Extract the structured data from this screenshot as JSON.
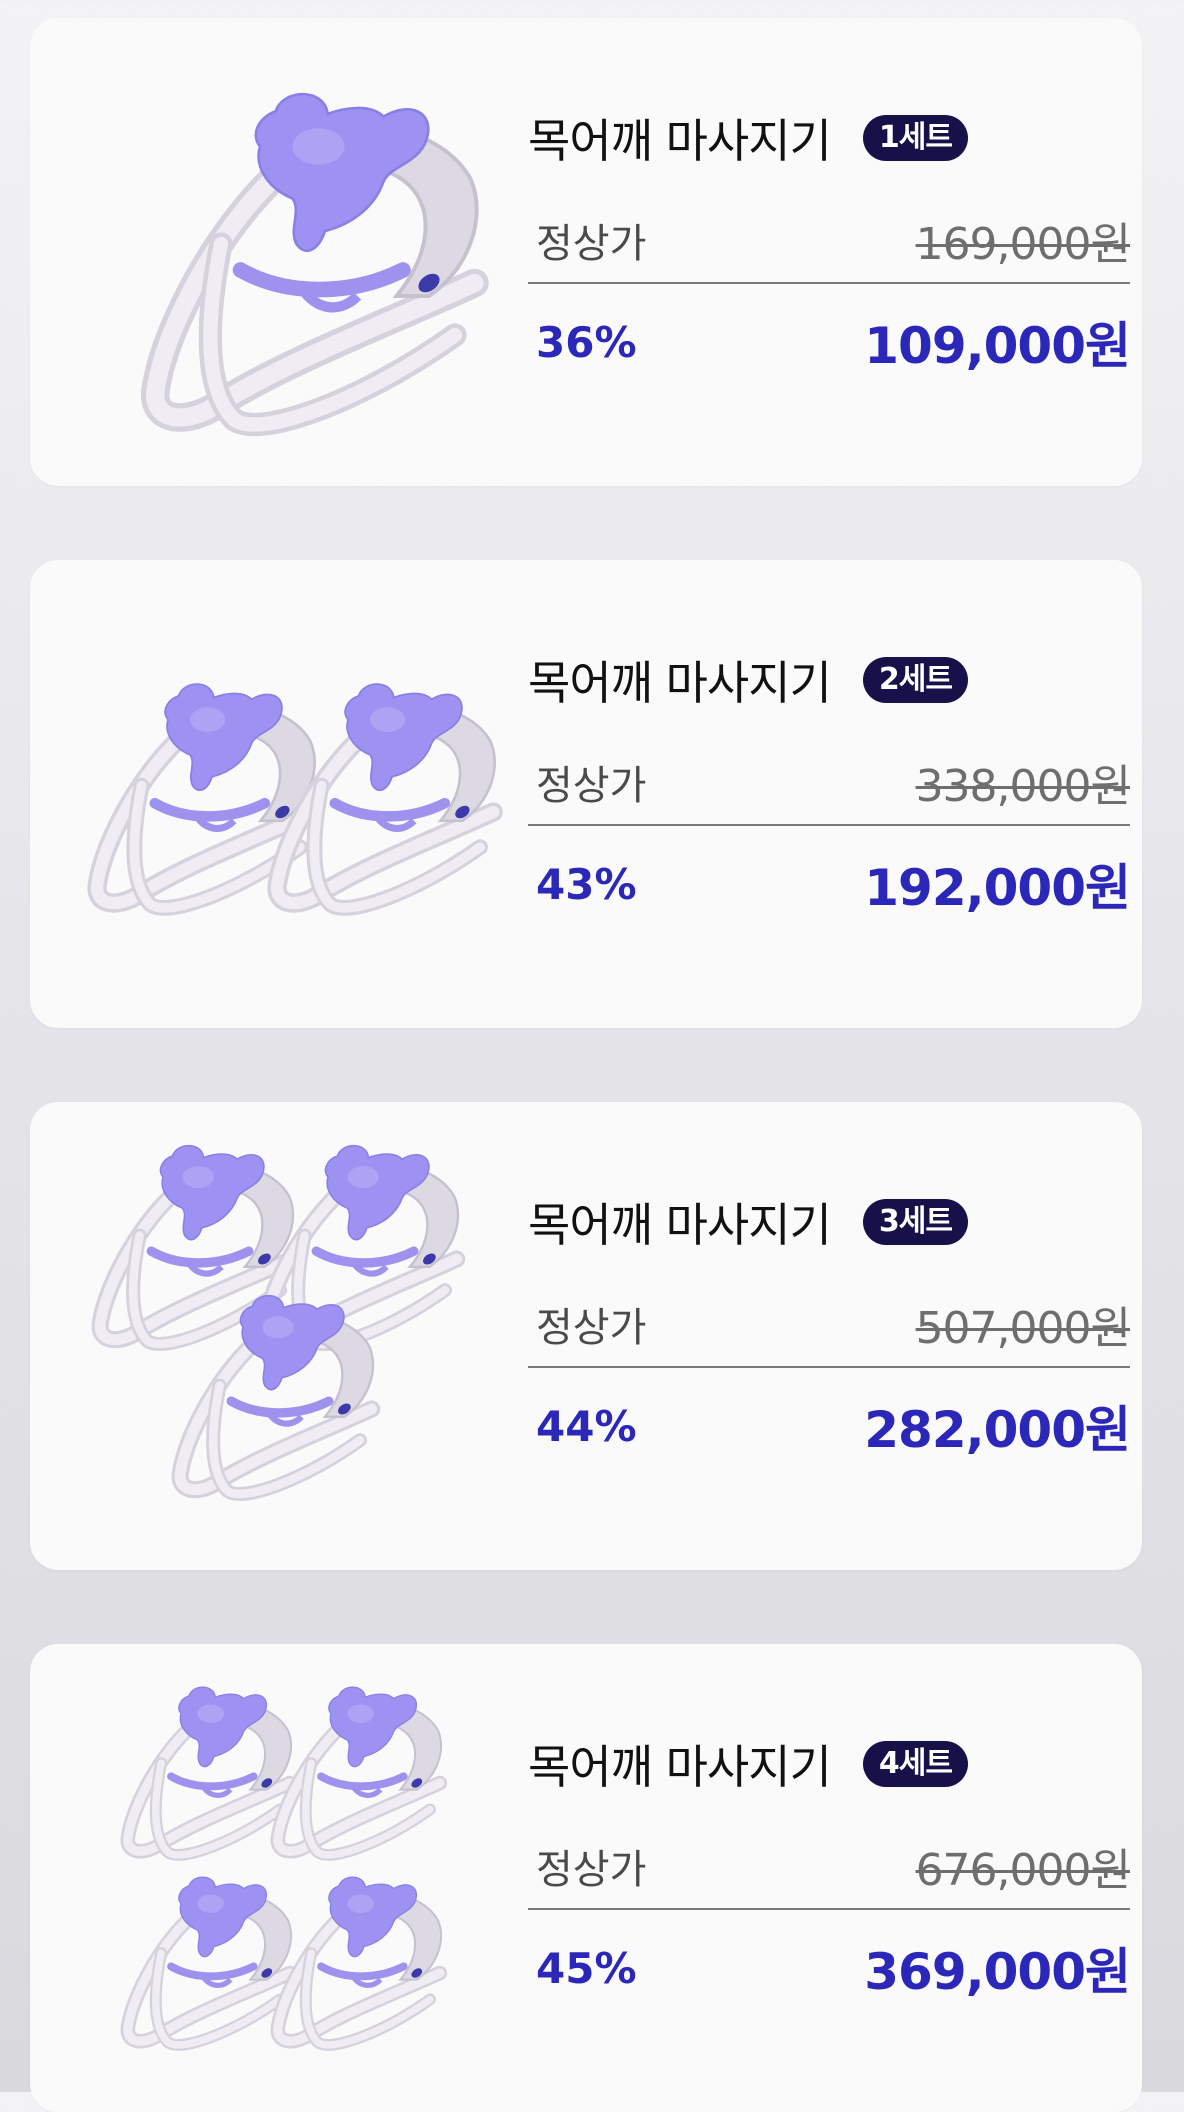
{
  "colors": {
    "accent": "#2b27b8",
    "badge_bg": "#17114a",
    "card_bg": "#fafafb",
    "device_purple": "#9b8ef0",
    "device_gray": "#e3e0ea"
  },
  "products": [
    {
      "title": "목어깨 마사지기",
      "badge": "1세트",
      "regular_label": "정상가",
      "regular_price": "169,000원",
      "discount": "36%",
      "sale_price": "109,000원",
      "image_icon": "neck-massager-image",
      "unit_count": 1
    },
    {
      "title": "목어깨 마사지기",
      "badge": "2세트",
      "regular_label": "정상가",
      "regular_price": "338,000원",
      "discount": "43%",
      "sale_price": "192,000원",
      "image_icon": "neck-massager-image",
      "unit_count": 2
    },
    {
      "title": "목어깨 마사지기",
      "badge": "3세트",
      "regular_label": "정상가",
      "regular_price": "507,000원",
      "discount": "44%",
      "sale_price": "282,000원",
      "image_icon": "neck-massager-image",
      "unit_count": 3
    },
    {
      "title": "목어깨 마사지기",
      "badge": "4세트",
      "regular_label": "정상가",
      "regular_price": "676,000원",
      "discount": "45%",
      "sale_price": "369,000원",
      "image_icon": "neck-massager-image",
      "unit_count": 4
    }
  ]
}
